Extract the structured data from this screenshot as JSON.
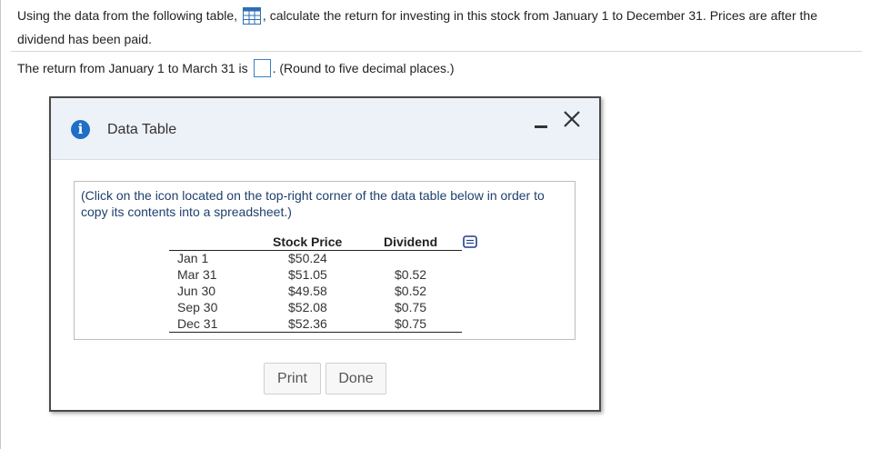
{
  "question": {
    "text_before": "Using the data from the following table,",
    "text_after": ", calculate the return for investing in this stock from January 1 to December 31. Prices are after the dividend has been paid."
  },
  "answer": {
    "prefix": "The return from January 1 to March 31 is",
    "suffix": ". (Round to five decimal places.)",
    "value": ""
  },
  "dialog": {
    "title": "Data Table",
    "instruction": "(Click on the icon located on the top-right corner of the data table below in order to copy its contents into a spreadsheet.)",
    "table": {
      "headers": [
        "",
        "Stock Price",
        "Dividend"
      ],
      "rows": [
        [
          "Jan 1",
          "$50.24",
          ""
        ],
        [
          "Mar 31",
          "$51.05",
          "$0.52"
        ],
        [
          "Jun 30",
          "$49.58",
          "$0.52"
        ],
        [
          "Sep 30",
          "$52.08",
          "$0.75"
        ],
        [
          "Dec 31",
          "$52.36",
          "$0.75"
        ]
      ]
    },
    "buttons": {
      "print": "Print",
      "done": "Done"
    }
  },
  "colors": {
    "accent": "#1e6fc6",
    "header_bg": "#edf1f8",
    "input_border": "#3b7fc4"
  }
}
